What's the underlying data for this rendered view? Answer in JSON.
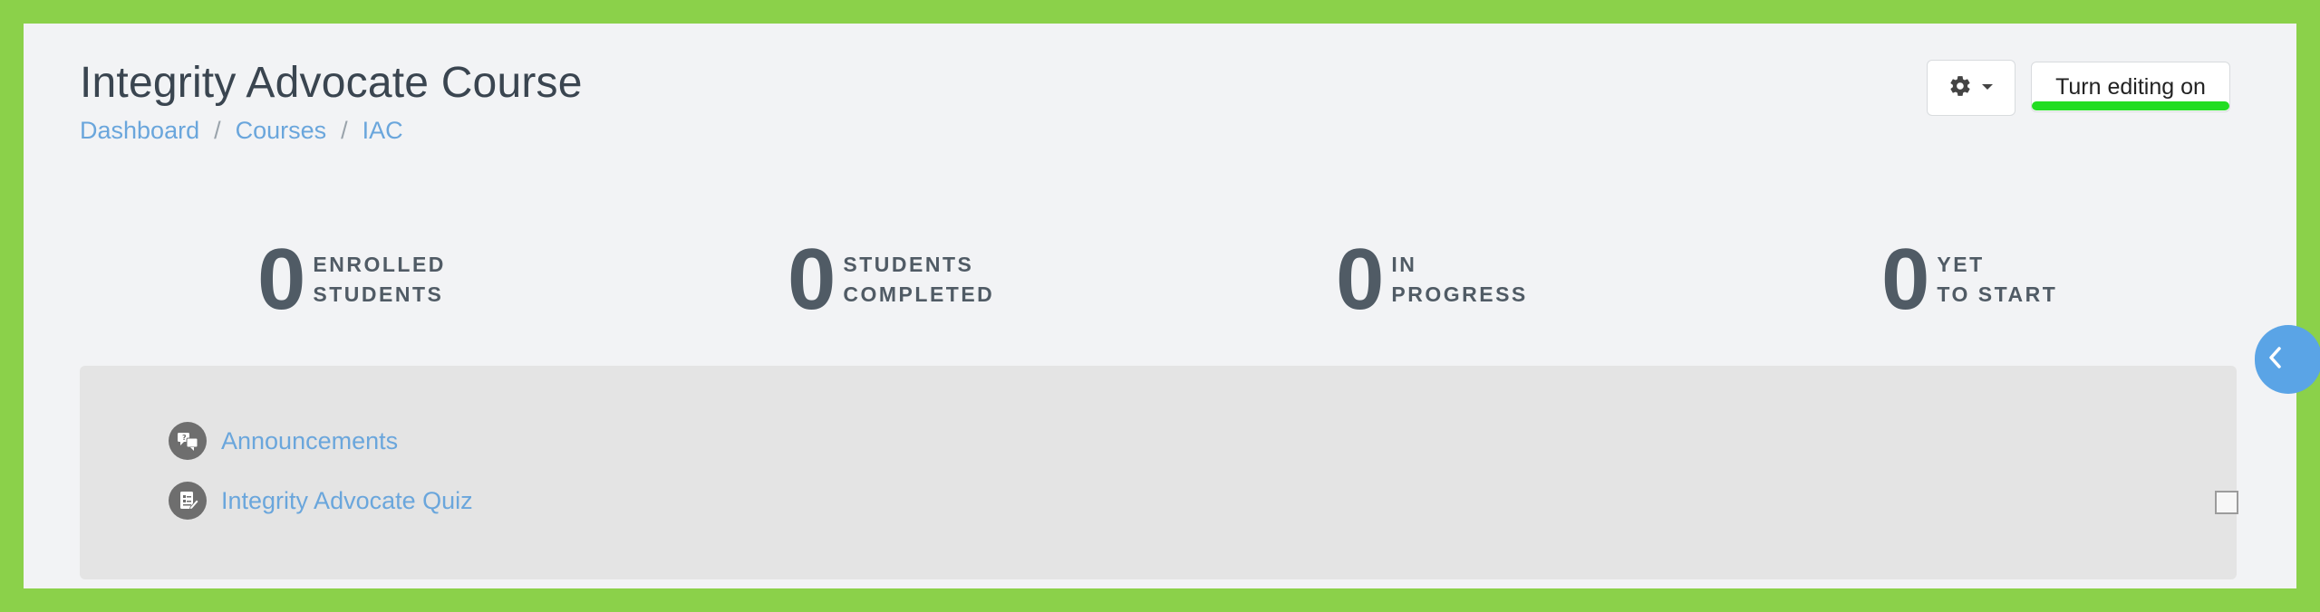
{
  "header": {
    "title": "Integrity Advocate Course",
    "breadcrumb": [
      "Dashboard",
      "Courses",
      "IAC"
    ],
    "breadcrumb_separator": "/",
    "settings_icon": "gear-icon",
    "edit_button_label": "Turn editing on"
  },
  "stats": [
    {
      "value": "0",
      "line1": "ENROLLED",
      "line2": "STUDENTS"
    },
    {
      "value": "0",
      "line1": "STUDENTS",
      "line2": "COMPLETED"
    },
    {
      "value": "0",
      "line1": "IN",
      "line2": "PROGRESS"
    },
    {
      "value": "0",
      "line1": "YET",
      "line2": "TO START"
    }
  ],
  "activities": [
    {
      "label": "Announcements",
      "icon": "forum-icon"
    },
    {
      "label": "Integrity Advocate Quiz",
      "icon": "quiz-icon"
    }
  ],
  "colors": {
    "frame_border": "#8bd14a",
    "link": "#6aa6dc",
    "highlight": "#22dd22",
    "drawer": "#5aa4e6"
  }
}
